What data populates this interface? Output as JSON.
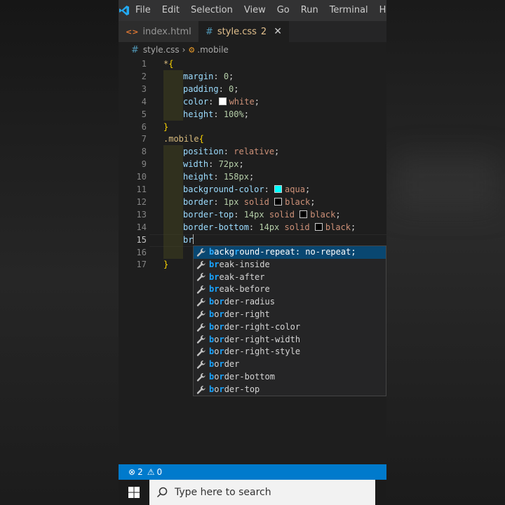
{
  "menu": [
    "File",
    "Edit",
    "Selection",
    "View",
    "Go",
    "Run",
    "Terminal",
    "Help"
  ],
  "tabs": [
    {
      "name": "index.html",
      "icon": "html-file-icon"
    },
    {
      "name": "style.css",
      "icon": "css-file-icon",
      "badge": "2"
    }
  ],
  "breadcrumb": {
    "file": "style.css",
    "symbol": ".mobile"
  },
  "code_lines": [
    {
      "n": "1",
      "text": "*{"
    },
    {
      "n": "2",
      "text": "margin: 0;"
    },
    {
      "n": "3",
      "text": "padding: 0;"
    },
    {
      "n": "4",
      "text": "color: white;"
    },
    {
      "n": "5",
      "text": "height: 100%;"
    },
    {
      "n": "6",
      "text": "}"
    },
    {
      "n": "7",
      "text": ".mobile{"
    },
    {
      "n": "8",
      "text": "position: relative;"
    },
    {
      "n": "9",
      "text": "width: 72px;"
    },
    {
      "n": "10",
      "text": "height: 158px;"
    },
    {
      "n": "11",
      "text": "background-color: aqua;"
    },
    {
      "n": "12",
      "text": "border: 1px solid black;"
    },
    {
      "n": "13",
      "text": "border-top: 14px solid black;"
    },
    {
      "n": "14",
      "text": "border-bottom: 14px solid black;"
    },
    {
      "n": "15",
      "text": "br"
    },
    {
      "n": "16",
      "text": ""
    },
    {
      "n": "17",
      "text": "}"
    }
  ],
  "colors": {
    "white": "#ffffff",
    "aqua": "#00ffff",
    "black": "#000000",
    "accent": "#007acc"
  },
  "suggestions": [
    "background-repeat: no-repeat;",
    "break-inside",
    "break-after",
    "break-before",
    "border-radius",
    "border-right",
    "border-right-color",
    "border-right-width",
    "border-right-style",
    "border",
    "border-bottom",
    "border-top"
  ],
  "status": {
    "errors": "2",
    "warnings": "0"
  },
  "taskbar": {
    "search_placeholder": "Type here to search"
  }
}
